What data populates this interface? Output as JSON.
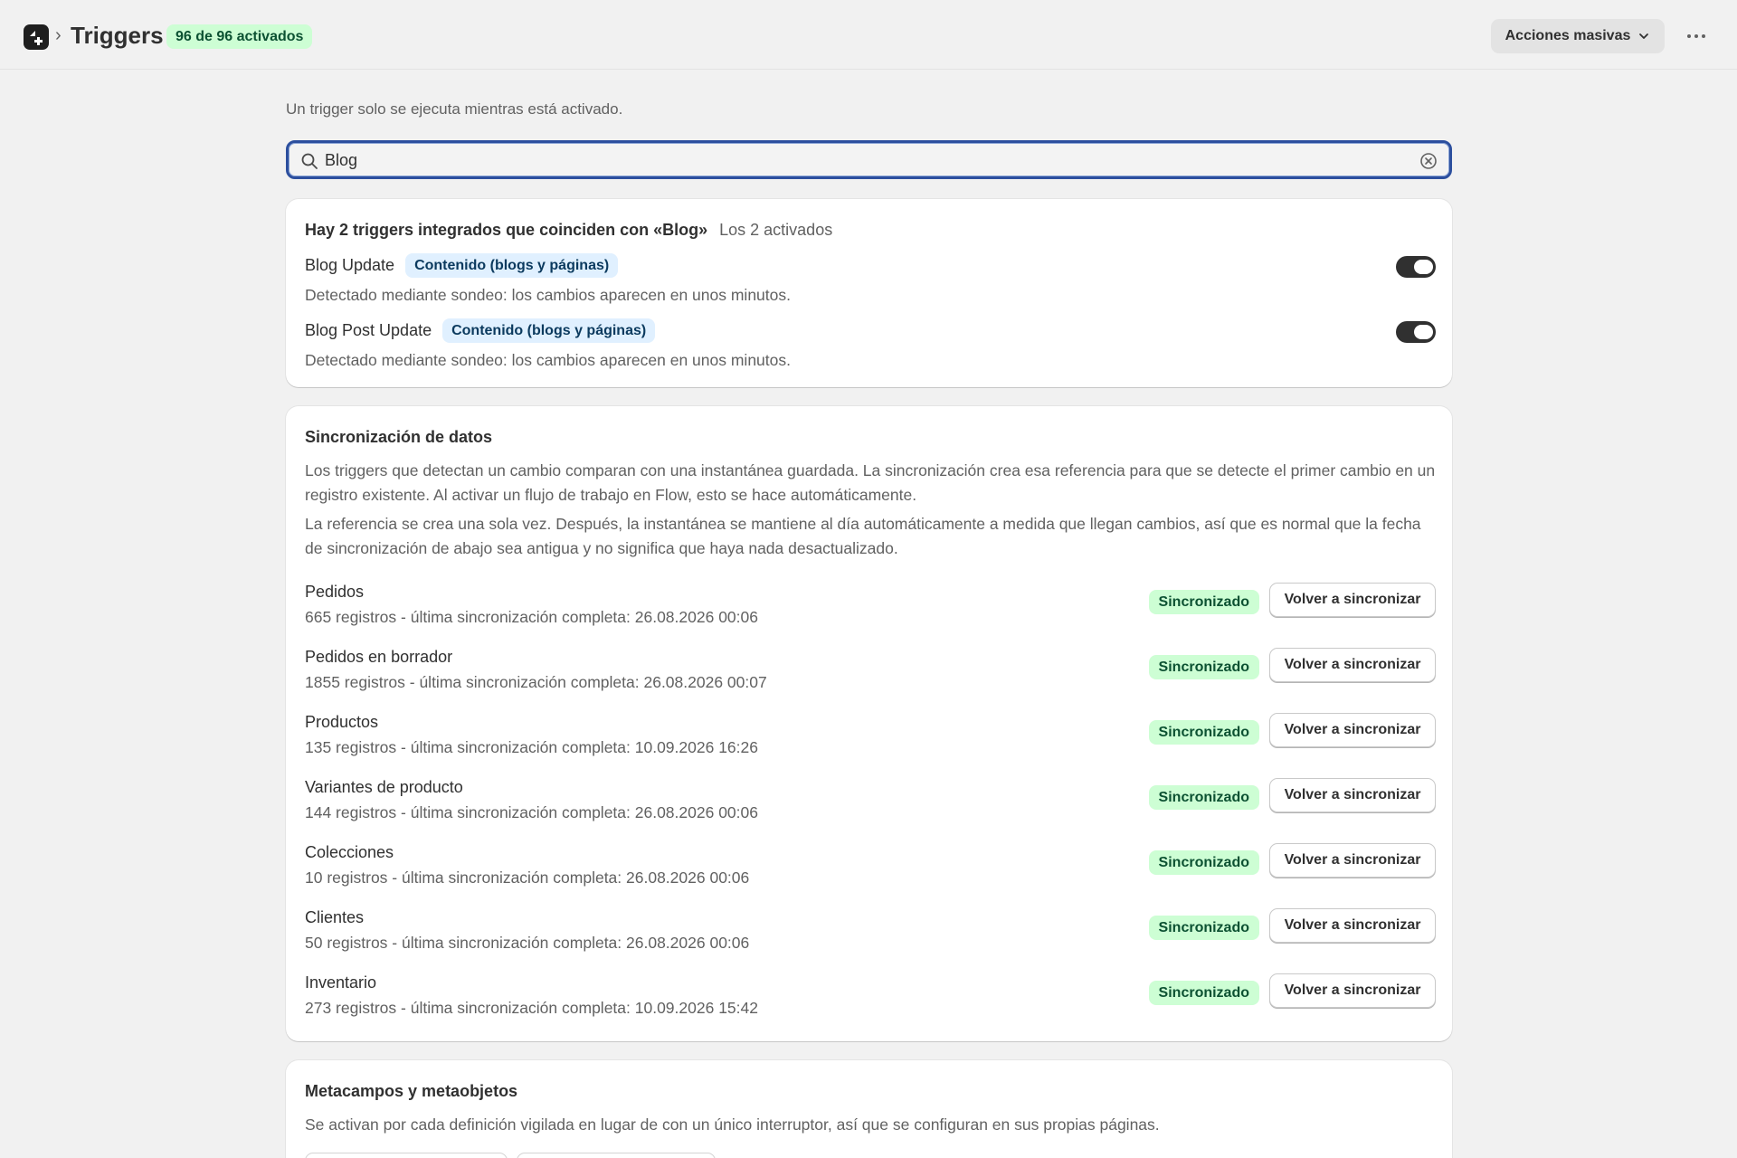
{
  "header": {
    "title": "Triggers",
    "badge": "96 de 96 activados",
    "bulk_actions_label": "Acciones masivas"
  },
  "helper_text": "Un trigger solo se ejecuta mientras está activado.",
  "search": {
    "value": "Blog",
    "placeholder": ""
  },
  "builtin": {
    "heading": "Hay 2 triggers integrados que coinciden con «Blog»",
    "sub": "Los 2 activados",
    "items": [
      {
        "name": "Blog Update",
        "tag": "Contenido (blogs y páginas)",
        "desc": "Detectado mediante sondeo: los cambios aparecen en unos minutos.",
        "enabled": true
      },
      {
        "name": "Blog Post Update",
        "tag": "Contenido (blogs y páginas)",
        "desc": "Detectado mediante sondeo: los cambios aparecen en unos minutos.",
        "enabled": true
      }
    ]
  },
  "sync": {
    "title": "Sincronización de datos",
    "para1": "Los triggers que detectan un cambio comparan con una instantánea guardada. La sincronización crea esa referencia para que se detecte el primer cambio en un registro existente. Al activar un flujo de trabajo en Flow, esto se hace automáticamente.",
    "para2": "La referencia se crea una sola vez. Después, la instantánea se mantiene al día automáticamente a medida que llegan cambios, así que es normal que la fecha de sincronización de abajo sea antigua y no significa que haya nada desactualizado.",
    "status_label": "Sincronizado",
    "resync_label": "Volver a sincronizar",
    "rows": [
      {
        "name": "Pedidos",
        "meta": "665 registros - última sincronización completa: 26.08.2026 00:06"
      },
      {
        "name": "Pedidos en borrador",
        "meta": "1855 registros - última sincronización completa: 26.08.2026 00:07"
      },
      {
        "name": "Productos",
        "meta": "135 registros - última sincronización completa: 10.09.2026 16:26"
      },
      {
        "name": "Variantes de producto",
        "meta": "144 registros - última sincronización completa: 26.08.2026 00:06"
      },
      {
        "name": "Colecciones",
        "meta": "10 registros - última sincronización completa: 26.08.2026 00:06"
      },
      {
        "name": "Clientes",
        "meta": "50 registros - última sincronización completa: 26.08.2026 00:06"
      },
      {
        "name": "Inventario",
        "meta": "273 registros - última sincronización completa: 10.09.2026 15:42"
      }
    ]
  },
  "meta": {
    "title": "Metacampos y metaobjetos",
    "desc": "Se activan por cada definición vigilada en lugar de con un único interruptor, así que se configuran en sus propias páginas."
  },
  "colors": {
    "accent_focus": "#2c4f9e",
    "success_bg": "#cdfed4",
    "success_text": "#0c5132",
    "tag_bg": "#e0f0ff",
    "toggle_on": "#303030"
  }
}
